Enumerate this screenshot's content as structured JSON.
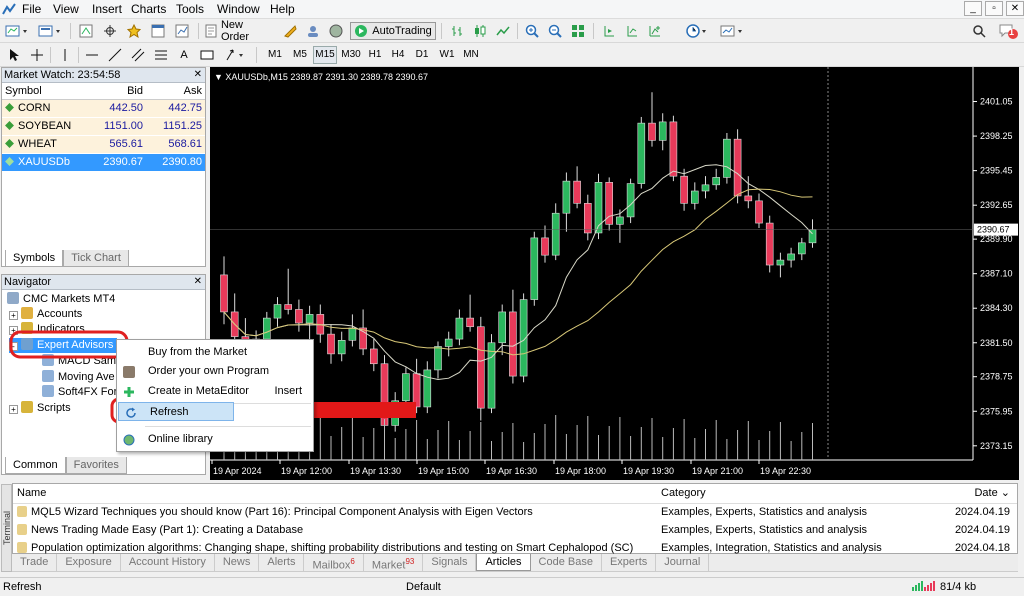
{
  "menu": [
    "File",
    "View",
    "Insert",
    "Charts",
    "Tools",
    "Window",
    "Help"
  ],
  "toolbar": {
    "new_order": "New Order",
    "autotrading": "AutoTrading"
  },
  "timeframes": [
    "M1",
    "M5",
    "M15",
    "M30",
    "H1",
    "H4",
    "D1",
    "W1",
    "MN"
  ],
  "timeframe_selected": "M15",
  "notif_count": "1",
  "market_watch": {
    "title": "Market Watch: 23:54:58",
    "headers": {
      "symbol": "Symbol",
      "bid": "Bid",
      "ask": "Ask"
    },
    "rows": [
      {
        "symbol": "CORN",
        "bid": "442.50",
        "ask": "442.75"
      },
      {
        "symbol": "SOYBEAN",
        "bid": "1151.00",
        "ask": "1151.25"
      },
      {
        "symbol": "WHEAT",
        "bid": "565.61",
        "ask": "568.61"
      },
      {
        "symbol": "XAUUSDb",
        "bid": "2390.67",
        "ask": "2390.80"
      }
    ],
    "tabs": [
      "Symbols",
      "Tick Chart"
    ]
  },
  "navigator": {
    "title": "Navigator",
    "root": "CMC Markets MT4",
    "items": [
      "Accounts",
      "Indicators",
      "Expert Advisors",
      "MACD Sam",
      "Moving Ave",
      "Soft4FX For",
      "Scripts"
    ],
    "tabs": [
      "Common",
      "Favorites"
    ]
  },
  "context_menu": {
    "items": [
      {
        "label": "Buy from the Market",
        "shortcut": ""
      },
      {
        "label": "Order your own Program",
        "shortcut": ""
      },
      {
        "label": "Create in MetaEditor",
        "shortcut": "Insert"
      },
      {
        "label": "Refresh",
        "shortcut": ""
      },
      {
        "label": "Online library",
        "shortcut": ""
      }
    ]
  },
  "chart_data": {
    "type": "candlestick",
    "header": "XAUUSDb,M15  2389.87 2391.30 2389.78 2390.67",
    "current_price": "2390.67",
    "ylim": [
      2372.0,
      2403.2
    ],
    "y_ticks": [
      "2401.05",
      "2398.25",
      "2395.45",
      "2392.65",
      "2389.90",
      "2387.10",
      "2384.30",
      "2381.50",
      "2378.75",
      "2375.95",
      "2373.15"
    ],
    "x_ticks": [
      "19 Apr 2024",
      "19 Apr 12:00",
      "19 Apr 13:30",
      "19 Apr 15:00",
      "19 Apr 16:30",
      "19 Apr 18:00",
      "19 Apr 19:30",
      "19 Apr 21:00",
      "19 Apr 22:30"
    ],
    "candles": [
      [
        2387.0,
        2388.5,
        2383.0,
        2384.0
      ],
      [
        2384.0,
        2385.5,
        2381.0,
        2382.0
      ],
      [
        2382.0,
        2383.5,
        2379.5,
        2380.5
      ],
      [
        2380.5,
        2382.5,
        2379.8,
        2381.8
      ],
      [
        2381.8,
        2384.0,
        2381.2,
        2383.5
      ],
      [
        2383.5,
        2385.2,
        2382.8,
        2384.6
      ],
      [
        2384.6,
        2387.5,
        2383.8,
        2384.2
      ],
      [
        2384.2,
        2385.0,
        2382.4,
        2383.1
      ],
      [
        2383.1,
        2384.5,
        2381.8,
        2383.8
      ],
      [
        2383.8,
        2384.6,
        2381.5,
        2382.2
      ],
      [
        2382.2,
        2383.0,
        2379.8,
        2380.6
      ],
      [
        2380.6,
        2382.4,
        2380.0,
        2381.7
      ],
      [
        2381.7,
        2383.8,
        2381.2,
        2382.7
      ],
      [
        2382.7,
        2384.2,
        2380.5,
        2381.0
      ],
      [
        2381.0,
        2381.8,
        2379.2,
        2379.8
      ],
      [
        2379.8,
        2380.5,
        2374.2,
        2374.8
      ],
      [
        2374.8,
        2377.5,
        2374.3,
        2376.8
      ],
      [
        2376.8,
        2379.5,
        2376.0,
        2379.0
      ],
      [
        2379.0,
        2380.2,
        2375.8,
        2376.3
      ],
      [
        2376.3,
        2380.0,
        2375.8,
        2379.3
      ],
      [
        2379.3,
        2381.6,
        2378.6,
        2381.2
      ],
      [
        2381.2,
        2382.4,
        2380.4,
        2381.8
      ],
      [
        2381.8,
        2384.2,
        2381.3,
        2383.5
      ],
      [
        2383.5,
        2385.4,
        2382.4,
        2382.8
      ],
      [
        2382.8,
        2383.6,
        2375.2,
        2376.2
      ],
      [
        2376.2,
        2382.2,
        2375.8,
        2381.5
      ],
      [
        2381.5,
        2384.6,
        2380.5,
        2384.0
      ],
      [
        2384.0,
        2385.8,
        2378.2,
        2378.8
      ],
      [
        2378.8,
        2385.5,
        2378.3,
        2385.0
      ],
      [
        2385.0,
        2390.5,
        2384.5,
        2390.0
      ],
      [
        2390.0,
        2391.0,
        2388.0,
        2388.6
      ],
      [
        2388.6,
        2392.8,
        2388.2,
        2392.0
      ],
      [
        2392.0,
        2395.3,
        2390.5,
        2394.6
      ],
      [
        2394.6,
        2395.8,
        2392.4,
        2392.8
      ],
      [
        2392.8,
        2393.5,
        2389.8,
        2390.4
      ],
      [
        2390.4,
        2395.2,
        2389.9,
        2394.5
      ],
      [
        2394.5,
        2394.9,
        2390.6,
        2391.1
      ],
      [
        2391.1,
        2392.3,
        2389.6,
        2391.7
      ],
      [
        2391.7,
        2394.8,
        2391.2,
        2394.4
      ],
      [
        2394.4,
        2399.8,
        2394.0,
        2399.3
      ],
      [
        2399.3,
        2401.8,
        2397.4,
        2397.9
      ],
      [
        2397.9,
        2400.1,
        2397.1,
        2399.4
      ],
      [
        2399.4,
        2399.9,
        2394.6,
        2395.0
      ],
      [
        2395.0,
        2395.6,
        2392.2,
        2392.8
      ],
      [
        2392.8,
        2394.5,
        2392.3,
        2393.8
      ],
      [
        2393.8,
        2395.0,
        2393.2,
        2394.3
      ],
      [
        2394.3,
        2395.6,
        2393.9,
        2394.9
      ],
      [
        2394.9,
        2398.5,
        2394.4,
        2398.0
      ],
      [
        2398.0,
        2398.8,
        2392.8,
        2393.4
      ],
      [
        2393.4,
        2395.0,
        2392.4,
        2393.0
      ],
      [
        2393.0,
        2393.6,
        2390.8,
        2391.2
      ],
      [
        2391.2,
        2391.8,
        2387.2,
        2387.8
      ],
      [
        2387.8,
        2388.8,
        2386.8,
        2388.2
      ],
      [
        2388.2,
        2389.2,
        2387.6,
        2388.7
      ],
      [
        2388.7,
        2390.0,
        2388.2,
        2389.6
      ],
      [
        2389.6,
        2391.5,
        2389.2,
        2390.67
      ]
    ]
  },
  "articles": {
    "headers": {
      "name": "Name",
      "category": "Category",
      "date": "Date"
    },
    "rows": [
      {
        "name": "MQL5 Wizard Techniques you should know (Part 16): Principal Component Analysis with Eigen Vectors",
        "category": "Examples, Experts, Statistics and analysis",
        "date": "2024.04.19"
      },
      {
        "name": "News Trading Made Easy (Part 1): Creating a Database",
        "category": "Examples, Experts, Statistics and analysis",
        "date": "2024.04.19"
      },
      {
        "name": "Population optimization algorithms: Changing shape, shifting probability distributions and testing on Smart Cephalopod (SC)",
        "category": "Examples, Integration, Statistics and analysis",
        "date": "2024.04.18"
      }
    ]
  },
  "terminal_label": "Terminal",
  "terminal_tabs": [
    {
      "label": "Trade",
      "badge": ""
    },
    {
      "label": "Exposure",
      "badge": ""
    },
    {
      "label": "Account History",
      "badge": ""
    },
    {
      "label": "News",
      "badge": ""
    },
    {
      "label": "Alerts",
      "badge": ""
    },
    {
      "label": "Mailbox",
      "badge": "6"
    },
    {
      "label": "Market",
      "badge": "93"
    },
    {
      "label": "Signals",
      "badge": ""
    },
    {
      "label": "Articles",
      "badge": ""
    },
    {
      "label": "Code Base",
      "badge": ""
    },
    {
      "label": "Experts",
      "badge": ""
    },
    {
      "label": "Journal",
      "badge": ""
    }
  ],
  "terminal_active": "Articles",
  "status": {
    "left": "Refresh",
    "profile": "Default",
    "traffic": "81/4 kb"
  },
  "colors": {
    "bull": "#2bb75e",
    "bear": "#e83a5a",
    "selection": "#3399ff",
    "annotation": "#e02020"
  }
}
